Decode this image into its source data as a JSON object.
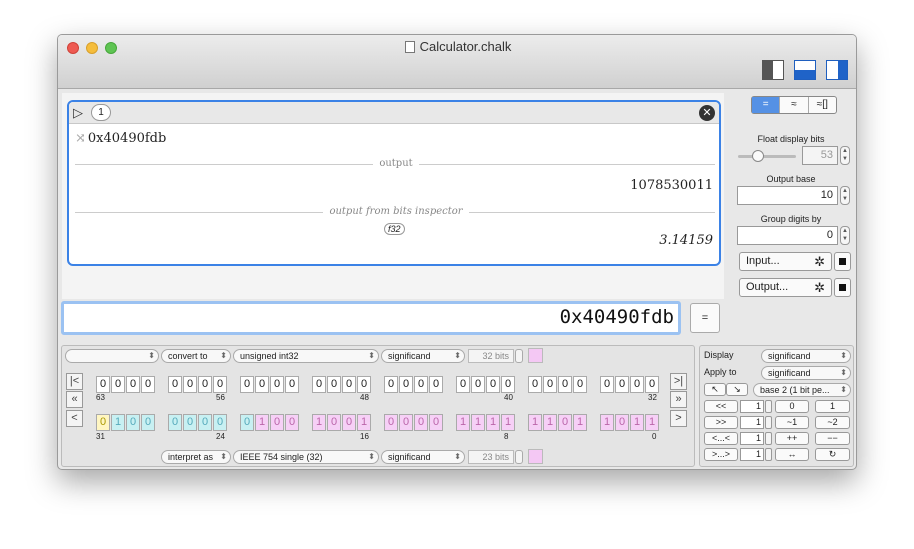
{
  "window": {
    "title": "Calculator.chalk"
  },
  "entry": {
    "number": "1",
    "input": "0x40490fdb",
    "output_label": "output",
    "output_value": "1078530011",
    "bits_label": "output from bits inspector",
    "bits_tag": "f32",
    "bits_value": "3.14159"
  },
  "command": {
    "value": "0x40490fdb",
    "equals_label": "="
  },
  "sidebar": {
    "seg": [
      "=",
      "≈",
      "≈[]"
    ],
    "float_bits_label": "Float display bits",
    "float_bits_value": "53",
    "float_bits_fraction": 0.3,
    "output_base_label": "Output base",
    "output_base_value": "10",
    "group_digits_label": "Group digits by",
    "group_digits_value": "0",
    "input_button": "Input...",
    "output_button": "Output..."
  },
  "bits": {
    "top_empty": "",
    "convert_to": "convert to",
    "convert_type": "unsigned int32",
    "top_significand": "significand",
    "top_bits": "32 bits",
    "interpret_as": "interpret as",
    "interpret_type": "IEEE 754 single (32)",
    "bottom_significand": "significand",
    "bottom_bits": "23 bits",
    "top_idx": [
      "63",
      "56",
      "48",
      "40",
      "32"
    ],
    "bottom_idx": [
      "31",
      "24",
      "16",
      "8",
      "0"
    ],
    "arrows_left": [
      "|<",
      "«",
      "<"
    ],
    "arrows_right": [
      ">|",
      "»",
      ">"
    ]
  },
  "ops": {
    "display_label": "Display",
    "display_value": "significand",
    "apply_label": "Apply to",
    "apply_value": "significand",
    "nav1": "↖",
    "nav2": "↘",
    "base_value": "base 2 (1 bit pe...",
    "row1": {
      "op": "<<",
      "n": "1",
      "b1": "0",
      "b2": "1"
    },
    "row2": {
      "op": ">>",
      "n": "1",
      "b1": "~1",
      "b2": "~2"
    },
    "row3": {
      "op": "<...<",
      "n": "1",
      "b1": "++",
      "b2": "−−"
    },
    "row4": {
      "op": ">...>",
      "n": "1",
      "b1": "↔",
      "b2": "↻"
    }
  }
}
